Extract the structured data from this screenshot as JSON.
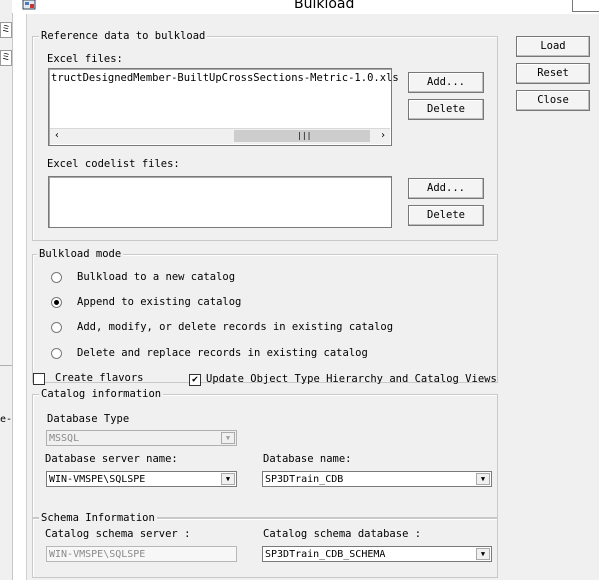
{
  "window": {
    "title": "Bulkload"
  },
  "parent": {
    "glyph_top": "ミ",
    "glyph_mid": "ミ",
    "fragment": "e-"
  },
  "reference": {
    "legend": "Reference data to bulkload",
    "excel_files_label": "Excel files:",
    "excel_files": [
      "tructDesignedMember-BuiltUpCrossSections-Metric-1.0.xls"
    ],
    "add_label": "Add...",
    "delete_label": "Delete",
    "codelist_label": "Excel codelist files:",
    "codelist_files": [],
    "add2_label": "Add...",
    "delete2_label": "Delete"
  },
  "actions": {
    "load": "Load",
    "reset": "Reset",
    "close": "Close"
  },
  "mode": {
    "legend": "Bulkload mode",
    "options": [
      {
        "label": "Bulkload to a new catalog",
        "selected": false
      },
      {
        "label": "Append to existing  catalog",
        "selected": true
      },
      {
        "label": "Add, modify, or delete records in existing catalog",
        "selected": false
      },
      {
        "label": "Delete and replace records in existing catalog",
        "selected": false
      }
    ]
  },
  "options": {
    "create_flavors": {
      "label": "Create flavors",
      "checked": false
    },
    "update_hierarchy": {
      "label": "Update Object Type Hierarchy and Catalog Views",
      "checked": true
    }
  },
  "catalog": {
    "legend": "Catalog information",
    "db_type_label": "Database Type",
    "db_type_value": "MSSQL",
    "server_label": "Database server name:",
    "server_value": "WIN-VMSPE\\SQLSPE",
    "dbname_label": "Database name:",
    "dbname_value": "SP3DTrain_CDB"
  },
  "schema": {
    "legend": "Schema Information",
    "server_label": "Catalog schema server :",
    "server_value": "WIN-VMSPE\\SQLSPE",
    "db_label": "Catalog schema database :",
    "db_value": "SP3DTrain_CDB_SCHEMA"
  }
}
